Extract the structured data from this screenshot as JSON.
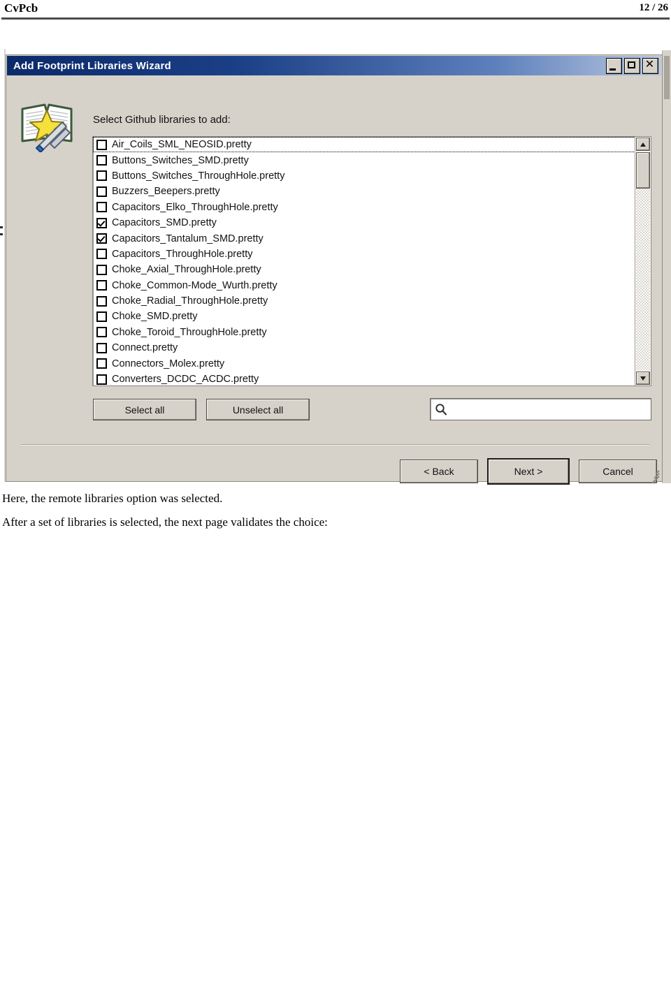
{
  "page": {
    "header_title": "CvPcb",
    "page_number": "12 / 26"
  },
  "dialog": {
    "title": "Add Footprint Libraries Wizard",
    "icon_name": "wizard-book-wand-icon",
    "titlebar_buttons": {
      "minimize": "minimize-icon",
      "maximize": "maximize-icon",
      "close": "close-icon"
    },
    "list_label": "Select Github libraries to add:",
    "libraries": [
      {
        "name": "Air_Coils_SML_NEOSID.pretty",
        "checked": false,
        "focused": true
      },
      {
        "name": "Buttons_Switches_SMD.pretty",
        "checked": false,
        "focused": false
      },
      {
        "name": "Buttons_Switches_ThroughHole.pretty",
        "checked": false,
        "focused": false
      },
      {
        "name": "Buzzers_Beepers.pretty",
        "checked": false,
        "focused": false
      },
      {
        "name": "Capacitors_Elko_ThroughHole.pretty",
        "checked": false,
        "focused": false
      },
      {
        "name": "Capacitors_SMD.pretty",
        "checked": true,
        "focused": false
      },
      {
        "name": "Capacitors_Tantalum_SMD.pretty",
        "checked": true,
        "focused": false
      },
      {
        "name": "Capacitors_ThroughHole.pretty",
        "checked": false,
        "focused": false
      },
      {
        "name": "Choke_Axial_ThroughHole.pretty",
        "checked": false,
        "focused": false
      },
      {
        "name": "Choke_Common-Mode_Wurth.pretty",
        "checked": false,
        "focused": false
      },
      {
        "name": "Choke_Radial_ThroughHole.pretty",
        "checked": false,
        "focused": false
      },
      {
        "name": "Choke_SMD.pretty",
        "checked": false,
        "focused": false
      },
      {
        "name": "Choke_Toroid_ThroughHole.pretty",
        "checked": false,
        "focused": false
      },
      {
        "name": "Connect.pretty",
        "checked": false,
        "focused": false
      },
      {
        "name": "Connectors_Molex.pretty",
        "checked": false,
        "focused": false
      },
      {
        "name": "Converters_DCDC_ACDC.pretty",
        "checked": false,
        "focused": false
      }
    ],
    "select_all_label": "Select all",
    "unselect_all_label": "Unselect all",
    "search": {
      "value": "",
      "placeholder": "",
      "icon_name": "search-icon"
    },
    "scrollbar": {
      "up_icon": "scroll-up-arrow-icon",
      "down_icon": "scroll-down-arrow-icon"
    },
    "nav": {
      "back_label": "< Back",
      "next_label": "Next >",
      "cancel_label": "Cancel"
    },
    "resize_grip_name": "resize-grip-icon"
  },
  "body_text": {
    "paragraph_1": "Here, the remote libraries option was selected.",
    "paragraph_2": "After a set of libraries is selected, the next page validates the choice:"
  },
  "colors": {
    "titlebar_start": "#0b2a6b",
    "titlebar_end": "#b9c8e0",
    "dialog_face": "#d6d2ca",
    "listbox_bg": "#ffffff",
    "text": "#111111",
    "header_rule": "#4c4c4c"
  }
}
